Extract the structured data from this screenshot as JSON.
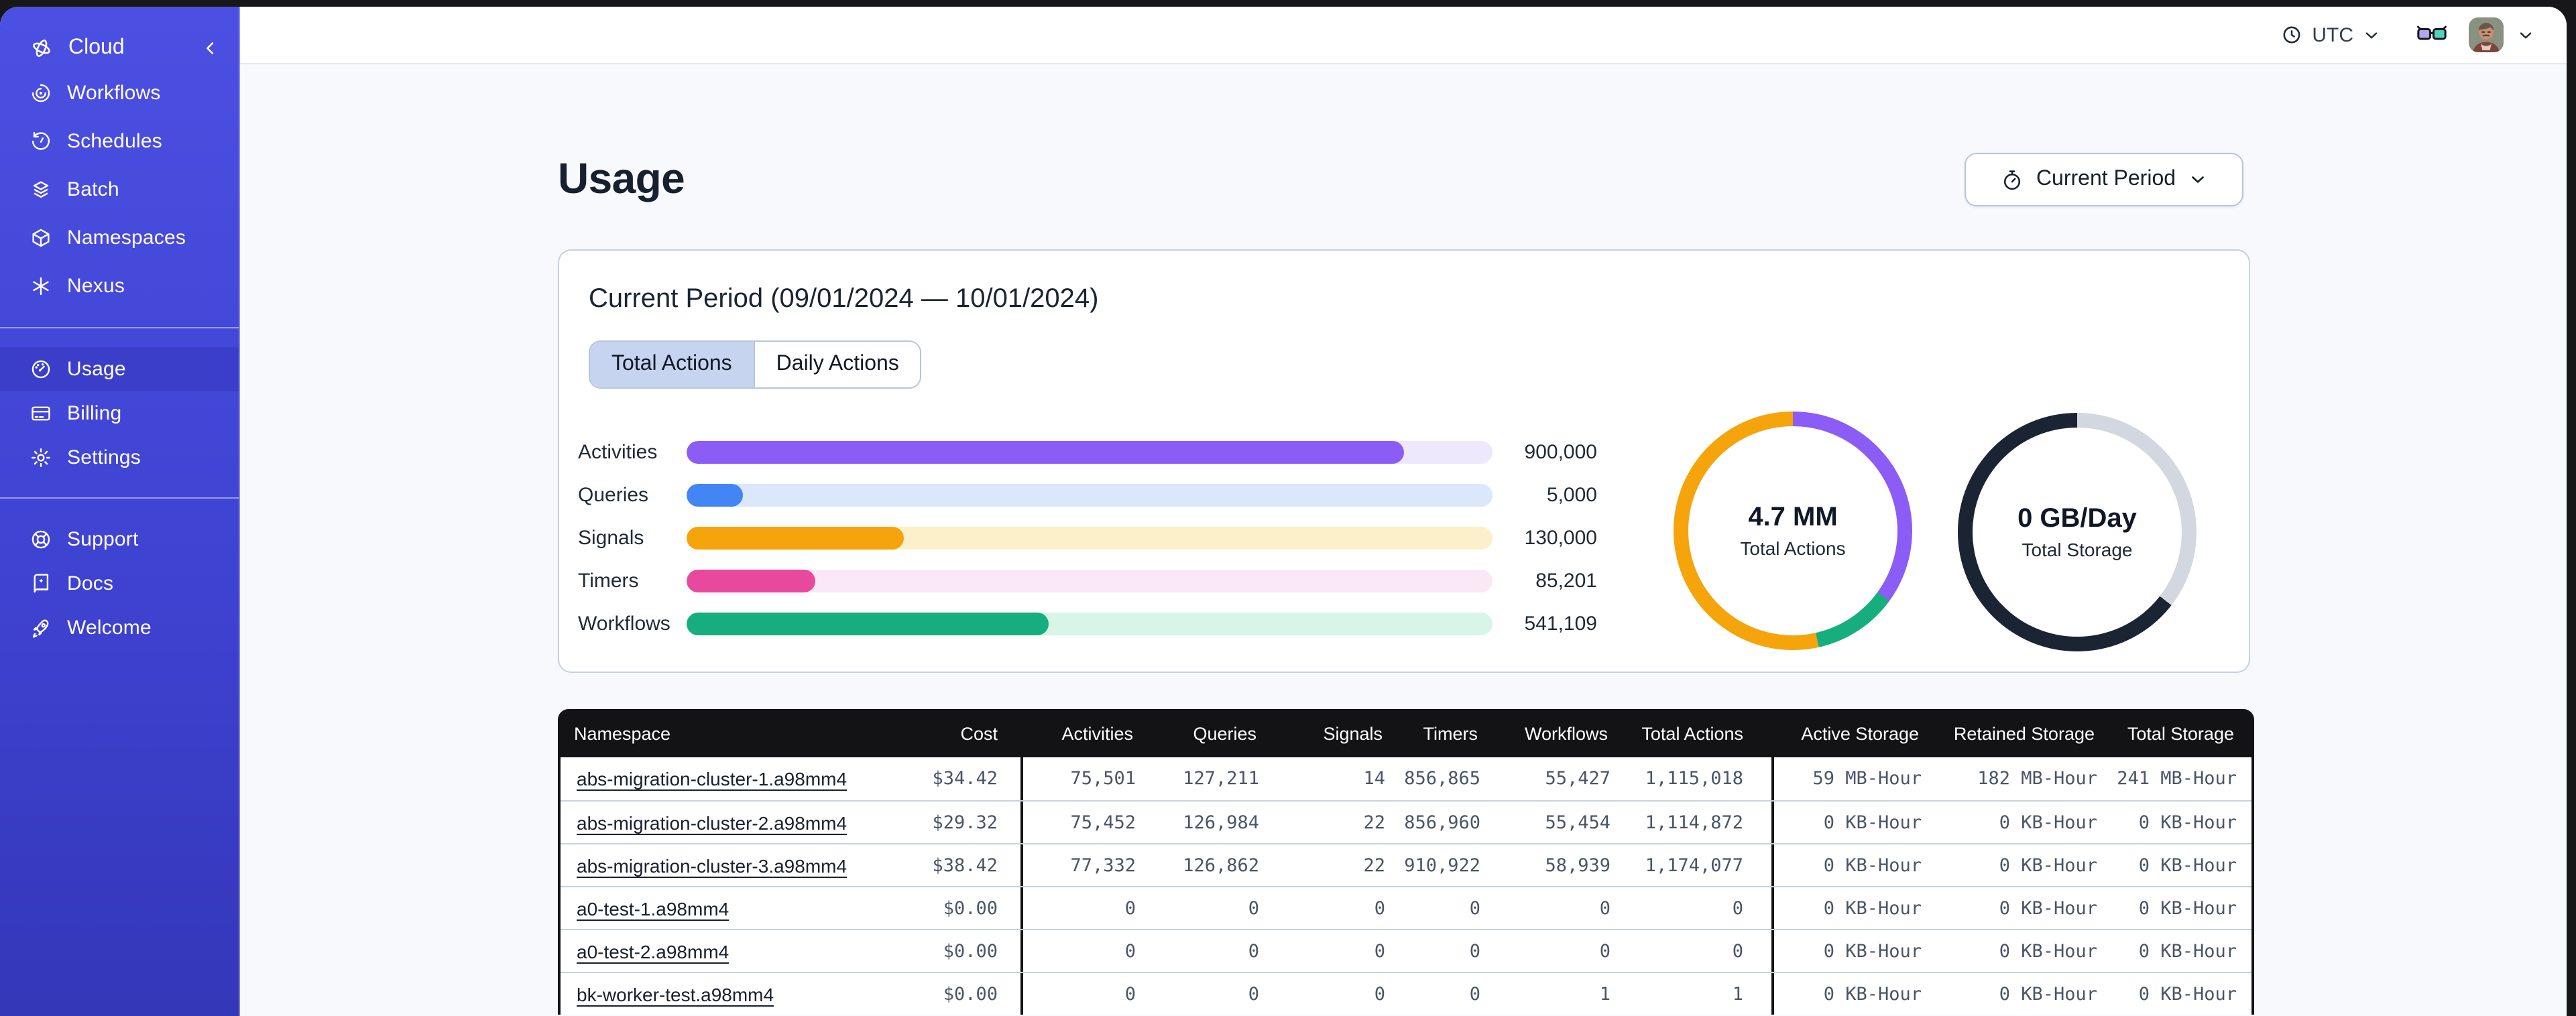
{
  "topbar": {
    "timezone_label": "UTC"
  },
  "sidebar": {
    "brand_label": "Cloud",
    "items": [
      {
        "id": "workflows",
        "label": "Workflows"
      },
      {
        "id": "schedules",
        "label": "Schedules"
      },
      {
        "id": "batch",
        "label": "Batch"
      },
      {
        "id": "namespaces",
        "label": "Namespaces"
      },
      {
        "id": "nexus",
        "label": "Nexus"
      },
      {
        "id": "usage",
        "label": "Usage",
        "active": true
      },
      {
        "id": "billing",
        "label": "Billing"
      },
      {
        "id": "settings",
        "label": "Settings"
      },
      {
        "id": "support",
        "label": "Support"
      },
      {
        "id": "docs",
        "label": "Docs"
      },
      {
        "id": "welcome",
        "label": "Welcome"
      }
    ]
  },
  "page": {
    "title": "Usage",
    "period_selector_label": "Current Period"
  },
  "usage_card": {
    "title": "Current Period (09/01/2024 — 10/01/2024)",
    "tabs": [
      {
        "label": "Total Actions",
        "active": true
      },
      {
        "label": "Daily Actions",
        "active": false
      }
    ]
  },
  "chart_data": [
    {
      "type": "bar",
      "orientation": "horizontal",
      "categories": [
        "Activities",
        "Queries",
        "Signals",
        "Timers",
        "Workflows"
      ],
      "values": [
        900000,
        5000,
        130000,
        85201,
        541109
      ],
      "value_labels": [
        "900,000",
        "5,000",
        "130,000",
        "85,201",
        "541,109"
      ],
      "fill_pct": [
        89,
        7,
        27,
        16,
        45
      ],
      "bar_colors": [
        "#8B5CF6",
        "#4285F4",
        "#F5A40B",
        "#E9499C",
        "#16AE7C"
      ],
      "track_colors": [
        "#EDE8FC",
        "#DBE7FB",
        "#FBF0C9",
        "#FBE8F7",
        "#D7F6E7"
      ]
    },
    {
      "type": "donut",
      "center_value": "4.7 MM",
      "center_label": "Total Actions",
      "segments": [
        {
          "color": "#8B5CF6",
          "pct": 35
        },
        {
          "color": "#16AE7C",
          "pct": 11.5
        },
        {
          "color": "#F5A40B",
          "pct": 53.5
        }
      ]
    },
    {
      "type": "donut",
      "center_value": "0 GB/Day",
      "center_label": "Total Storage",
      "segments": [
        {
          "color": "#D3D7DF",
          "pct": 35.5
        },
        {
          "color": "#1B2433",
          "pct": 64.5
        }
      ]
    }
  ],
  "table": {
    "columns": [
      "Namespace",
      "Cost",
      "Activities",
      "Queries",
      "Signals",
      "Timers",
      "Workflows",
      "Total Actions",
      "Active Storage",
      "Retained Storage",
      "Total Storage"
    ],
    "rows": [
      [
        "abs-migration-cluster-1.a98mm4",
        "$34.42",
        "75,501",
        "127,211",
        "14",
        "856,865",
        "55,427",
        "1,115,018",
        "59 MB-Hour",
        "182 MB-Hour",
        "241 MB-Hour"
      ],
      [
        "abs-migration-cluster-2.a98mm4",
        "$29.32",
        "75,452",
        "126,984",
        "22",
        "856,960",
        "55,454",
        "1,114,872",
        "0 KB-Hour",
        "0 KB-Hour",
        "0 KB-Hour"
      ],
      [
        "abs-migration-cluster-3.a98mm4",
        "$38.42",
        "77,332",
        "126,862",
        "22",
        "910,922",
        "58,939",
        "1,174,077",
        "0 KB-Hour",
        "0 KB-Hour",
        "0 KB-Hour"
      ],
      [
        "a0-test-1.a98mm4",
        "$0.00",
        "0",
        "0",
        "0",
        "0",
        "0",
        "0",
        "0 KB-Hour",
        "0 KB-Hour",
        "0 KB-Hour"
      ],
      [
        "a0-test-2.a98mm4",
        "$0.00",
        "0",
        "0",
        "0",
        "0",
        "0",
        "0",
        "0 KB-Hour",
        "0 KB-Hour",
        "0 KB-Hour"
      ],
      [
        "bk-worker-test.a98mm4",
        "$0.00",
        "0",
        "0",
        "0",
        "0",
        "1",
        "1",
        "0 KB-Hour",
        "0 KB-Hour",
        "0 KB-Hour"
      ]
    ]
  }
}
